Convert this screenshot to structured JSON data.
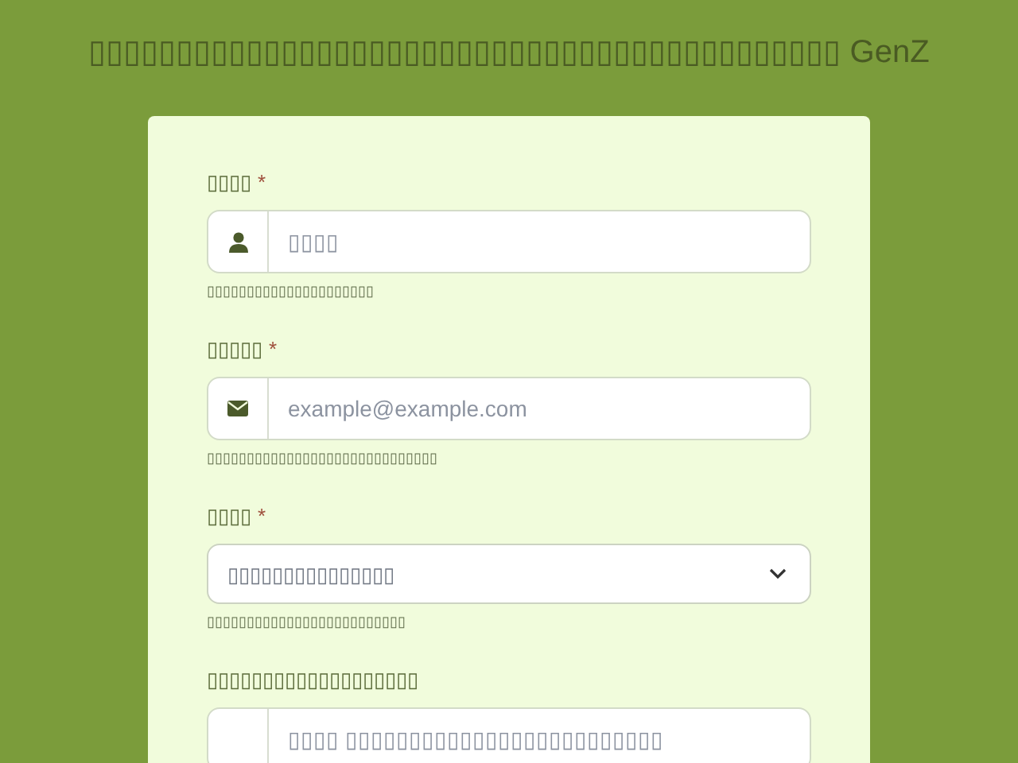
{
  "title": "▯▯▯▯▯▯▯▯▯▯▯▯▯▯▯▯▯▯▯▯▯▯▯▯▯▯▯▯▯▯▯▯▯▯▯▯▯▯▯▯▯▯▯ GenZ",
  "fields": [
    {
      "kind": "user",
      "label": "▯▯▯▯",
      "required_mark": "*",
      "placeholder": "▯▯▯▯",
      "hint": "▯▯▯▯▯▯▯▯▯▯▯▯▯▯▯▯▯▯▯▯▯"
    },
    {
      "kind": "email",
      "label": "▯▯▯▯▯",
      "required_mark": "*",
      "placeholder": "example@example.com",
      "hint": "▯▯▯▯▯▯▯▯▯▯▯▯▯▯▯▯▯▯▯▯▯▯▯▯▯▯▯▯▯"
    },
    {
      "kind": "select",
      "label": "▯▯▯▯",
      "required_mark": "*",
      "placeholder": "▯▯▯▯▯▯▯▯▯▯▯▯▯▯▯",
      "hint": "▯▯▯▯▯▯▯▯▯▯▯▯▯▯▯▯▯▯▯▯▯▯▯▯▯"
    },
    {
      "kind": "text",
      "label": "▯▯▯▯▯▯▯▯▯▯▯▯▯▯▯▯▯▯▯",
      "placeholder": "▯▯▯▯ ▯▯▯▯▯▯▯▯▯▯▯▯▯▯▯▯▯▯▯▯▯▯▯▯▯"
    }
  ]
}
